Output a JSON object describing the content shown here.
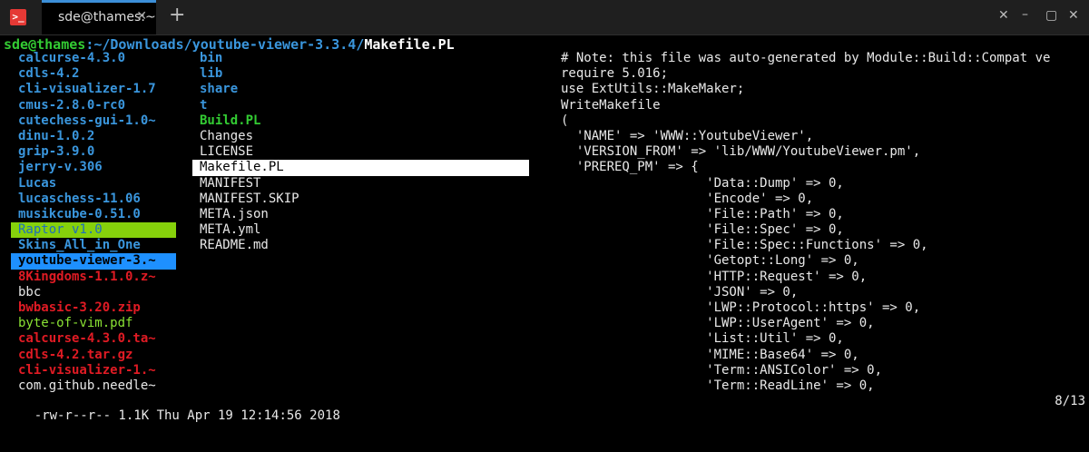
{
  "window": {
    "tab_title": "sde@thames:~",
    "tab_close_icon": "✕",
    "new_tab_icon": "+",
    "controls": [
      "✕",
      "–",
      "▢",
      "✕"
    ]
  },
  "prompt": {
    "user": "sde@thames",
    "path": ":~/Downloads/youtube-viewer-3.3.4/",
    "file": "Makefile.PL"
  },
  "col1": [
    {
      "text": "calcurse-4.3.0",
      "kind": "dir"
    },
    {
      "text": "cdls-4.2",
      "kind": "dir"
    },
    {
      "text": "cli-visualizer-1.7",
      "kind": "dir"
    },
    {
      "text": "cmus-2.8.0-rc0",
      "kind": "dir"
    },
    {
      "text": "cutechess-gui-1.0~",
      "kind": "dir"
    },
    {
      "text": "dinu-1.0.2",
      "kind": "dir"
    },
    {
      "text": "grip-3.9.0",
      "kind": "dir"
    },
    {
      "text": "jerry-v.306",
      "kind": "dir"
    },
    {
      "text": "Lucas",
      "kind": "dir"
    },
    {
      "text": "lucaschess-11.06",
      "kind": "dir"
    },
    {
      "text": "musikcube-0.51.0",
      "kind": "dir"
    },
    {
      "text": "Raptor v1.0",
      "kind": "hl-green"
    },
    {
      "text": "Skins_All_in_One",
      "kind": "dir"
    },
    {
      "text": "youtube-viewer-3.~",
      "kind": "hl-blue"
    },
    {
      "text": "8Kingdoms-1.1.0.z~",
      "kind": "arch"
    },
    {
      "text": "bbc",
      "kind": "plain"
    },
    {
      "text": "bwbasic-3.20.zip",
      "kind": "arch"
    },
    {
      "text": "byte-of-vim.pdf",
      "kind": "doc"
    },
    {
      "text": "calcurse-4.3.0.ta~",
      "kind": "arch"
    },
    {
      "text": "cdls-4.2.tar.gz",
      "kind": "arch"
    },
    {
      "text": "cli-visualizer-1.~",
      "kind": "arch"
    },
    {
      "text": "com.github.needle~",
      "kind": "plain"
    }
  ],
  "col2": [
    {
      "text": "bin",
      "kind": "dir"
    },
    {
      "text": "lib",
      "kind": "dir"
    },
    {
      "text": "share",
      "kind": "dir"
    },
    {
      "text": "t",
      "kind": "dir"
    },
    {
      "text": "Build.PL",
      "kind": "exe"
    },
    {
      "text": "Changes",
      "kind": "plain"
    },
    {
      "text": "LICENSE",
      "kind": "plain"
    },
    {
      "text": "Makefile.PL",
      "kind": "hl-white"
    },
    {
      "text": "MANIFEST",
      "kind": "plain"
    },
    {
      "text": "MANIFEST.SKIP",
      "kind": "plain"
    },
    {
      "text": "META.json",
      "kind": "plain"
    },
    {
      "text": "META.yml",
      "kind": "plain"
    },
    {
      "text": "README.md",
      "kind": "plain"
    }
  ],
  "preview": [
    "# Note: this file was auto-generated by Module::Build::Compat ve",
    "require 5.016;",
    "use ExtUtils::MakeMaker;",
    "WriteMakefile",
    "(",
    "  'NAME' => 'WWW::YoutubeViewer',",
    "  'VERSION_FROM' => 'lib/WWW/YoutubeViewer.pm',",
    "  'PREREQ_PM' => {",
    "                   'Data::Dump' => 0,",
    "                   'Encode' => 0,",
    "                   'File::Path' => 0,",
    "                   'File::Spec' => 0,",
    "                   'File::Spec::Functions' => 0,",
    "                   'Getopt::Long' => 0,",
    "                   'HTTP::Request' => 0,",
    "                   'JSON' => 0,",
    "                   'LWP::Protocol::https' => 0,",
    "                   'LWP::UserAgent' => 0,",
    "                   'List::Util' => 0,",
    "                   'MIME::Base64' => 0,",
    "                   'Term::ANSIColor' => 0,",
    "                   'Term::ReadLine' => 0,"
  ],
  "status": {
    "info": "-rw-r--r-- 1.1K Thu Apr 19 12:14:56 2018",
    "position": "8/13"
  }
}
